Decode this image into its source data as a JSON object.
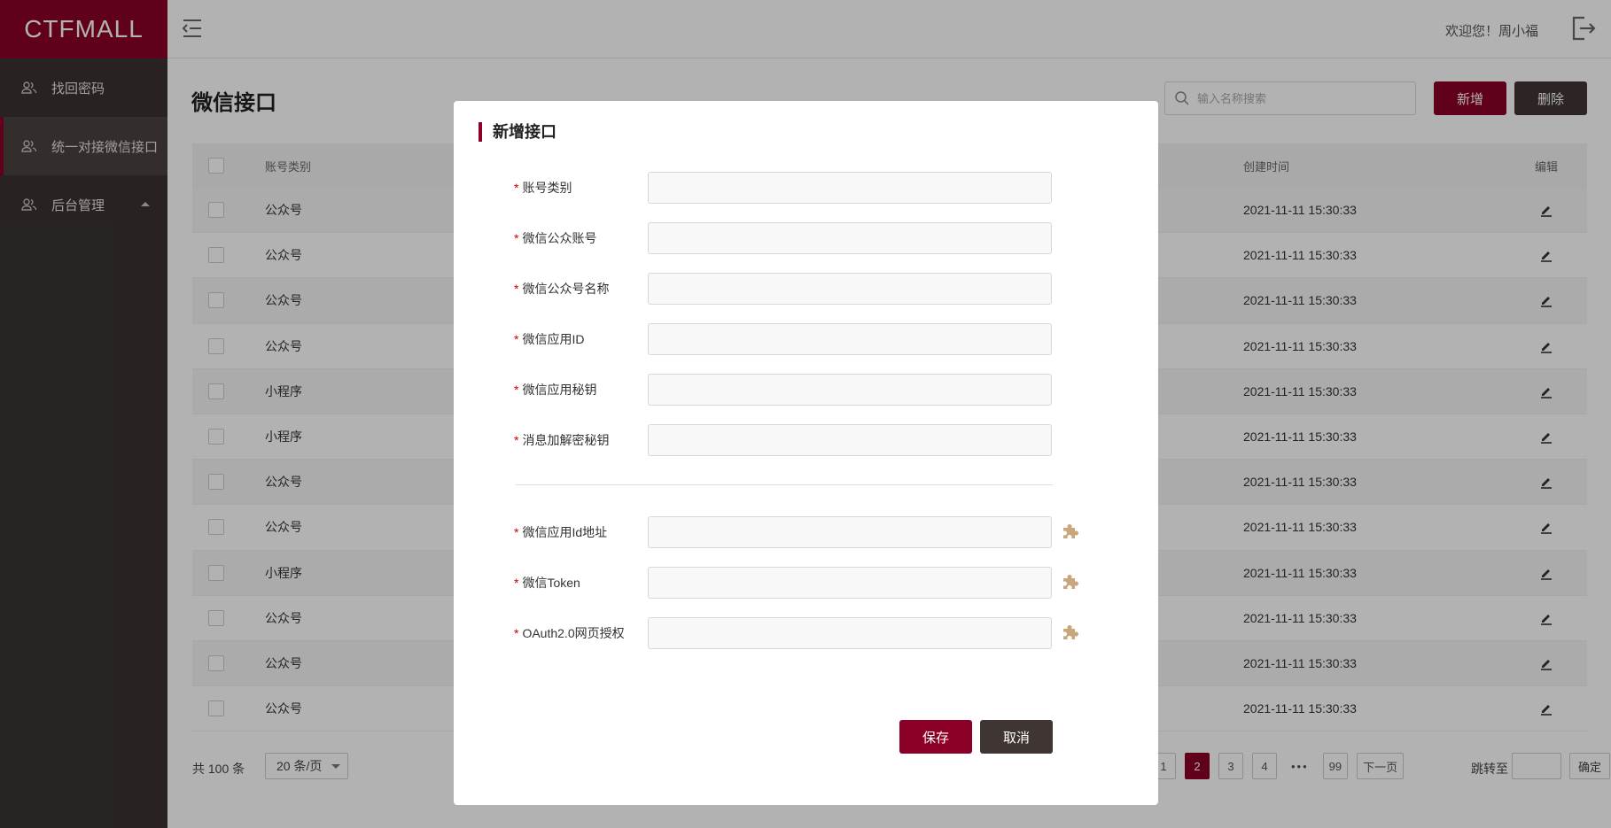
{
  "app": {
    "logo": "CTFMALL"
  },
  "sidebar": {
    "items": [
      {
        "label": "找回密码",
        "icon": "users-icon"
      },
      {
        "label": "统一对接微信接口",
        "icon": "users-icon",
        "active": true
      },
      {
        "label": "后台管理",
        "icon": "users-icon",
        "expandable": true
      }
    ]
  },
  "header": {
    "welcome": "欢迎您！周小福"
  },
  "main": {
    "title": "微信接口",
    "search_placeholder": "输入名称搜索",
    "add_label": "新增",
    "delete_label": "删除",
    "columns": {
      "type": "账号类别",
      "time": "创建时间",
      "edit": "编辑"
    },
    "rows": [
      {
        "type": "公众号",
        "time": "2021-11-11  15:30:33"
      },
      {
        "type": "公众号",
        "time": "2021-11-11  15:30:33"
      },
      {
        "type": "公众号",
        "time": "2021-11-11  15:30:33"
      },
      {
        "type": "公众号",
        "time": "2021-11-11  15:30:33"
      },
      {
        "type": "小程序",
        "time": "2021-11-11  15:30:33"
      },
      {
        "type": "小程序",
        "time": "2021-11-11  15:30:33"
      },
      {
        "type": "公众号",
        "time": "2021-11-11  15:30:33"
      },
      {
        "type": "公众号",
        "time": "2021-11-11  15:30:33"
      },
      {
        "type": "小程序",
        "time": "2021-11-11  15:30:33"
      },
      {
        "type": "公众号",
        "time": "2021-11-11  15:30:33"
      },
      {
        "type": "公众号",
        "time": "2021-11-11  15:30:33"
      },
      {
        "type": "公众号",
        "time": "2021-11-11  15:30:33"
      }
    ],
    "footer": {
      "total": "共 100 条",
      "per_page": "20 条/页",
      "pages": [
        "1",
        "2",
        "3",
        "4",
        "•••",
        "99"
      ],
      "active_page": "2",
      "next": "下一页",
      "jump_label": "跳转至",
      "confirm": "确定"
    }
  },
  "modal": {
    "title": "新增接口",
    "fields": [
      {
        "label": "账号类别",
        "value": ""
      },
      {
        "label": "微信公众账号",
        "value": ""
      },
      {
        "label": "微信公众号名称",
        "value": ""
      },
      {
        "label": "微信应用ID",
        "value": ""
      },
      {
        "label": "微信应用秘钥",
        "value": ""
      },
      {
        "label": "消息加解密秘钥",
        "value": ""
      }
    ],
    "extra_fields": [
      {
        "label": "微信应用Id地址",
        "value": ""
      },
      {
        "label": "微信Token",
        "value": ""
      },
      {
        "label": "OAuth2.0网页授权",
        "value": ""
      }
    ],
    "required_mark": "*",
    "save_label": "保存",
    "cancel_label": "取消"
  },
  "colors": {
    "brand": "#8c0028",
    "dark": "#3f3533",
    "puzzle": "#c9a77c"
  }
}
